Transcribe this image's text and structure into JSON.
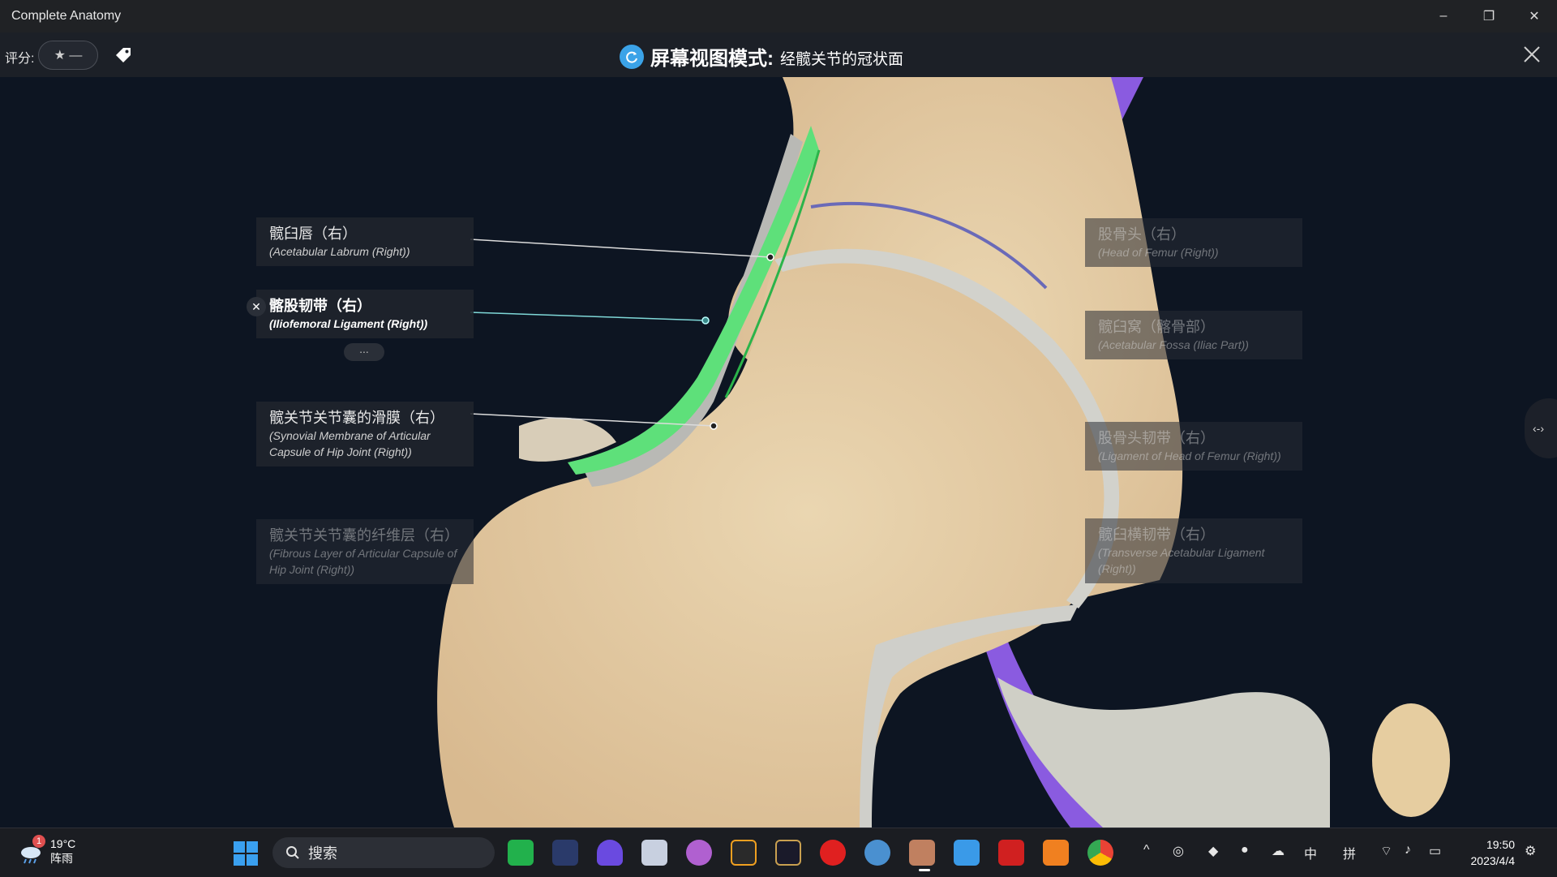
{
  "window": {
    "title": "Complete Anatomy",
    "controls": [
      "–",
      "❐",
      "✕"
    ]
  },
  "toolbar": {
    "rating_label": "评分:",
    "rating_value": "★ —",
    "mode_title": "屏幕视图模式:",
    "mode_subtitle": "经髋关节的冠状面"
  },
  "labels_left": [
    {
      "zh": "髋臼唇（右）",
      "en": "(Acetabular Labrum (Right))",
      "state": "normal"
    },
    {
      "zh": "髂股韧带（右）",
      "en": "(Iliofemoral Ligament (Right))",
      "state": "active"
    },
    {
      "zh": "髋关节关节囊的滑膜（右）",
      "en": "(Synovial Membrane of Articular Capsule of Hip Joint (Right))",
      "state": "normal"
    },
    {
      "zh": "髋关节关节囊的纤维层（右）",
      "en": "(Fibrous Layer of Articular Capsule of Hip Joint (Right))",
      "state": "faded"
    }
  ],
  "labels_right": [
    {
      "zh": "股骨头（右）",
      "en": "(Head of Femur (Right))",
      "state": "faded"
    },
    {
      "zh": "髋臼窝（髂骨部）",
      "en": "(Acetabular Fossa (Iliac Part))",
      "state": "faded"
    },
    {
      "zh": "股骨头韧带（右）",
      "en": "(Ligament of Head of Femur (Right))",
      "state": "faded"
    },
    {
      "zh": "髋臼横韧带（右）",
      "en": "(Transverse Acetabular Ligament (Right))",
      "state": "faded"
    }
  ],
  "label_controls": {
    "close": "✕",
    "more": "..."
  },
  "side_handle": "‹-›",
  "colors": {
    "ligament_green": "#5ee07a",
    "bone": "#e6cfa8",
    "cartilage": "#d8d8d2",
    "purple": "#8a5be0",
    "background": "#0d1522"
  },
  "taskbar": {
    "weather_temp": "19°C",
    "weather_desc": "阵雨",
    "weather_badge": "1",
    "search_placeholder": "搜索",
    "tray_ime_1": "中",
    "tray_ime_2": "拼",
    "time": "19:50",
    "date": "2023/4/4"
  }
}
